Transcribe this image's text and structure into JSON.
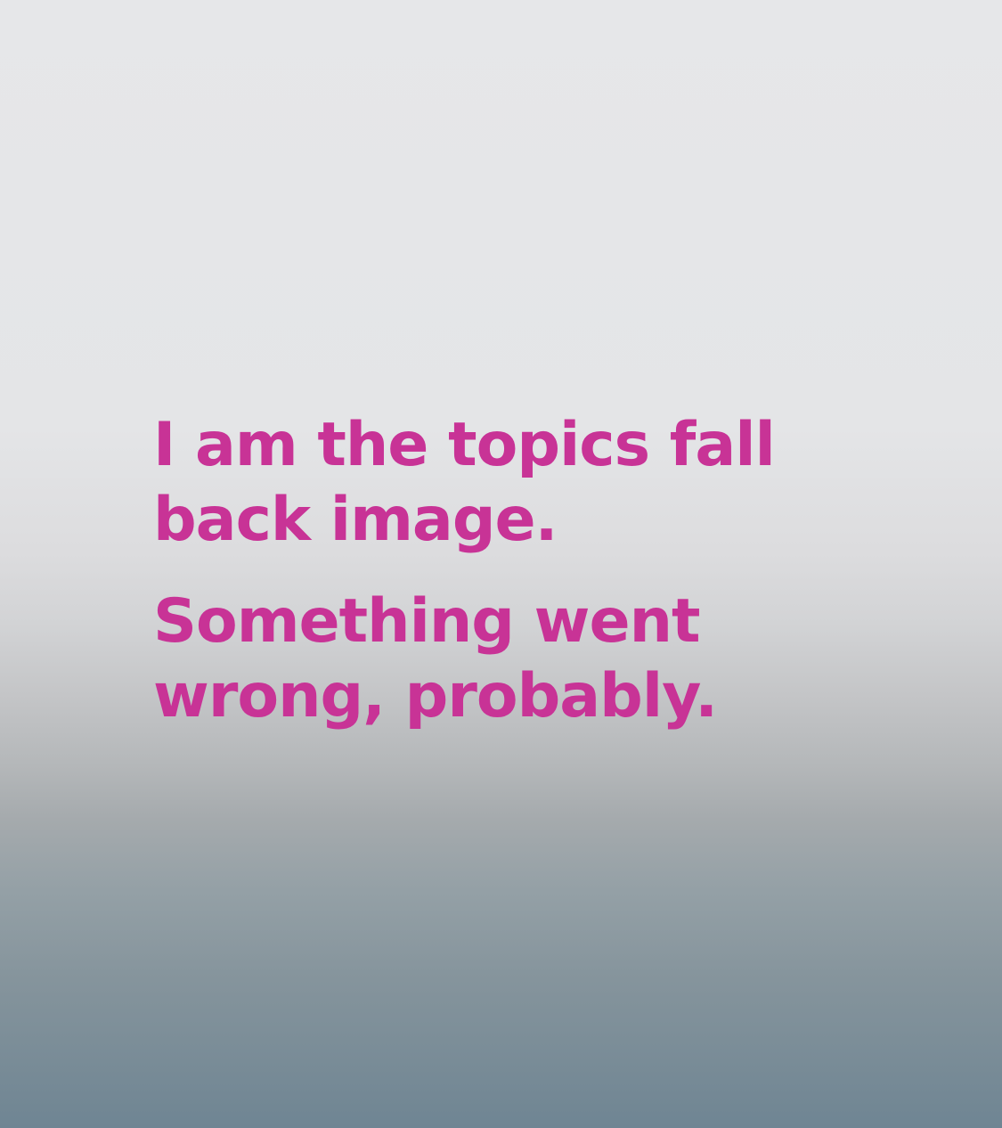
{
  "fallback": {
    "line1": "I am the topics fall\nback image.",
    "line2": "Something went\nwrong, probably."
  },
  "colors": {
    "text": "#c83396",
    "background_top": "#e6e7e9",
    "background_bottom": "#6f8593"
  }
}
